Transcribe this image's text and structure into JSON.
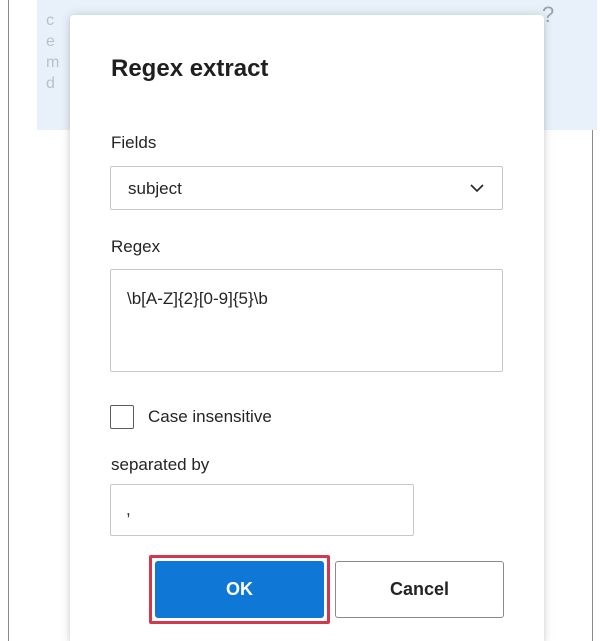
{
  "background": {
    "partial_lines": [
      "c",
      "e",
      "m",
      "d"
    ],
    "help_glyph": "?"
  },
  "dialog": {
    "title": "Regex extract",
    "fields": {
      "label": "Fields",
      "selected": "subject",
      "icon": "chevron-down-icon"
    },
    "regex": {
      "label": "Regex",
      "value": "\\b[A-Z]{2}[0-9]{5}\\b"
    },
    "case_insensitive": {
      "label": "Case insensitive",
      "checked": false
    },
    "separator": {
      "label": "separated by",
      "value": ","
    },
    "buttons": {
      "ok": "OK",
      "cancel": "Cancel"
    }
  },
  "colors": {
    "primary": "#0f78d7",
    "highlight": "#d4384f",
    "background_panel": "#e8f1fa"
  }
}
